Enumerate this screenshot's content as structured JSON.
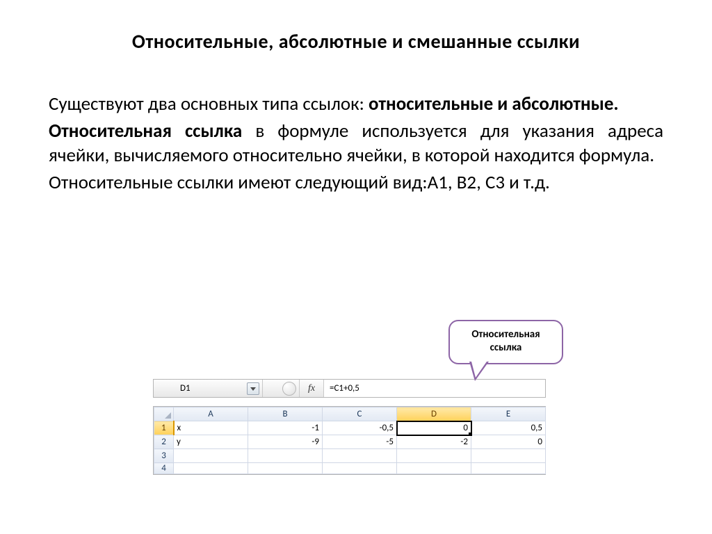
{
  "title": "Относительные, абсолютные и  смешанные ссылки",
  "p1_a": "Существуют два основных типа ссылок: ",
  "p1_b": "относительные и абсолютные.",
  "p2_a": "Относительная ссылка",
  "p2_b": " в формуле используется для указания адреса ячейки, вычисляемого относительно ячейки, в которой находится формула.",
  "p3": "Относительные ссылки имеют следующий вид:А1, В2, С3 и т.д.",
  "callout_l1": "Относительная",
  "callout_l2": "ссылка",
  "excel": {
    "name_box": "D1",
    "fx_label": "fx",
    "formula": "=C1+0,5",
    "columns": [
      "A",
      "B",
      "C",
      "D",
      "E"
    ],
    "rows": [
      {
        "n": "1",
        "label": "x",
        "b": "-1",
        "c": "-0,5",
        "d": "0",
        "e": "0,5"
      },
      {
        "n": "2",
        "label": "y",
        "b": "-9",
        "c": "-5",
        "d": "-2",
        "e": "0"
      }
    ],
    "empty_rows": [
      "3",
      "4"
    ]
  }
}
